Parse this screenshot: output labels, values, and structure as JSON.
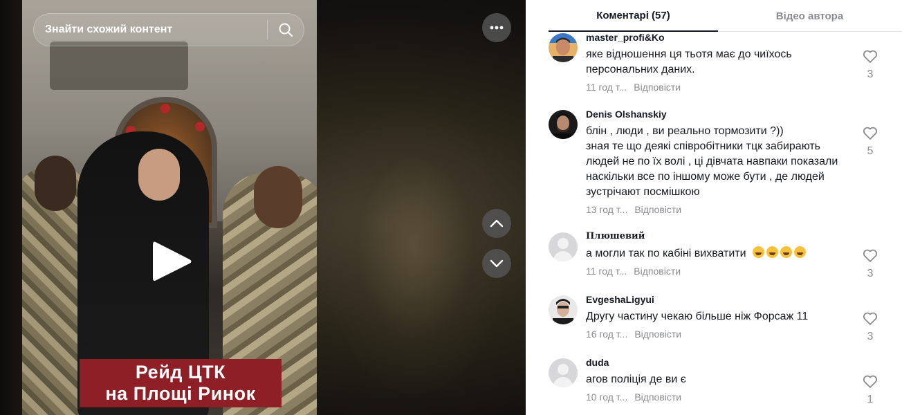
{
  "search": {
    "placeholder": "Знайти схожий контент"
  },
  "video": {
    "caption_line1": "Рейд ЦТК",
    "caption_line2": "на Площі Ринок"
  },
  "tabs": {
    "comments": "Коментарі (57)",
    "author_videos": "Відео автора"
  },
  "reply_label": "Відповісти",
  "comments": [
    {
      "username": "master_profi&Ko",
      "text": "яке відношення ця тьотя має до чиїхось персональних даних.",
      "time": "11 год т...",
      "likes": "3"
    },
    {
      "username": "Denis Olshanskiy",
      "text_lines": [
        "блін , люди , ви реально тормозити ?))",
        "зная те що деякі співробітники тцк забирають",
        "людей не по їх волі , ці дівчата навпаки показали",
        "наскільки все по іншому може бути , де людей",
        "зустрічают посмішкою"
      ],
      "time": "13 год т...",
      "likes": "5"
    },
    {
      "username": "Плюшевий",
      "text": "а могли так по кабіні вихватити",
      "emoji_count": 4,
      "time": "11 год т...",
      "likes": "3"
    },
    {
      "username": "EvgeshaLigyui",
      "text": "Другу частину чекаю більше ніж Форсаж 11",
      "time": "16 год т...",
      "likes": "3"
    },
    {
      "username": "duda",
      "text": "агов поліція де ви є",
      "time": "10 год т...",
      "likes": "1"
    }
  ],
  "icons": {
    "search": "search-icon",
    "more": "more-dots-icon",
    "play": "play-icon",
    "up": "chevron-up-icon",
    "down": "chevron-down-icon",
    "like": "heart-outline-icon"
  },
  "colors": {
    "caption_bg": "#8e1f26",
    "text_primary": "#161823",
    "text_secondary": "#8a8b91"
  }
}
